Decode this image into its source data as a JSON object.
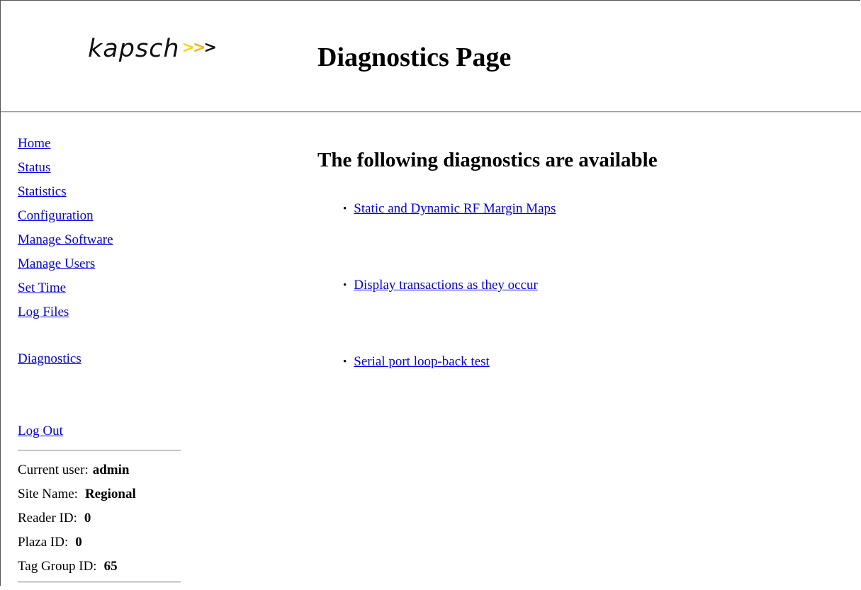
{
  "header": {
    "logo_text": "kapsch",
    "logo_arrows": [
      ">",
      ">",
      ">"
    ],
    "title": "Diagnostics Page"
  },
  "sidebar": {
    "nav": [
      {
        "label": "Home"
      },
      {
        "label": "Status"
      },
      {
        "label": "Statistics"
      },
      {
        "label": "Configuration"
      },
      {
        "label": "Manage Software"
      },
      {
        "label": "Manage Users"
      },
      {
        "label": "Set Time"
      },
      {
        "label": "Log Files"
      },
      {
        "label": "Diagnostics"
      },
      {
        "label": "Log Out"
      }
    ],
    "info": {
      "current_user_label": "Current user:",
      "current_user_value": "admin",
      "site_name_label": "Site Name:",
      "site_name_value": "Regional",
      "reader_id_label": "Reader ID:",
      "reader_id_value": "0",
      "plaza_id_label": "Plaza ID:",
      "plaza_id_value": "0",
      "tag_group_id_label": "Tag Group ID:",
      "tag_group_id_value": "65"
    }
  },
  "main": {
    "heading": "The following diagnostics are available",
    "bullet": "•",
    "items": [
      {
        "label": "Static and Dynamic RF Margin Maps"
      },
      {
        "label": "Display transactions as they occur"
      },
      {
        "label": "Serial port loop-back test"
      }
    ]
  },
  "colors": {
    "link": "#0000ee",
    "logo_arrow_1": "#f7d31a",
    "logo_arrow_2": "#f5b41c",
    "logo_arrow_3": "#111111"
  }
}
